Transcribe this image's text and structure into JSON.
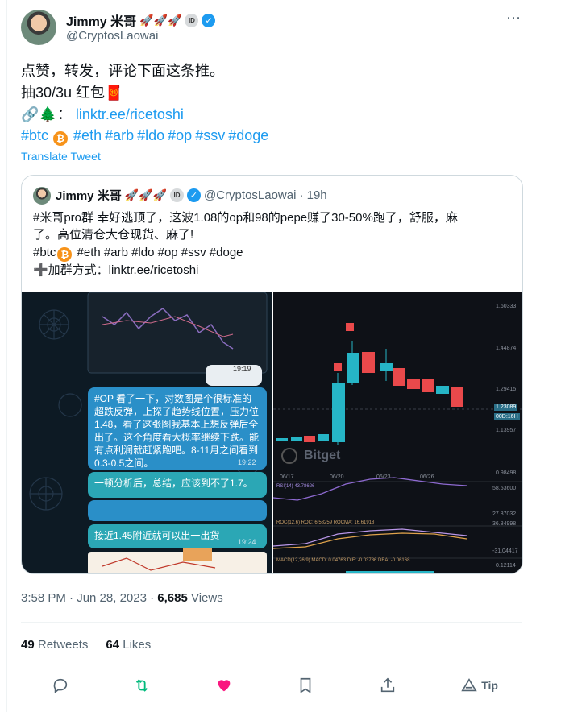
{
  "tweet": {
    "author_name": "Jimmy 米哥",
    "author_emoji": "🚀🚀🚀",
    "id_badge": "ID",
    "handle": "@CryptosLaowai",
    "more_icon": "⋯",
    "lines": [
      "点赞，转发，评论下面这条推。",
      "抽30/3u 红包🧧"
    ],
    "link_prefix": "🔗🌲：",
    "link_text": "linktr.ee/ricetoshi",
    "hashtags": [
      "#btc",
      "#eth",
      "#arb",
      "#ldo",
      "#op",
      "#ssv",
      "#doge"
    ],
    "translate_label": "Translate Tweet"
  },
  "quote": {
    "author_name": "Jimmy 米哥",
    "author_emoji": "🚀🚀🚀",
    "id_badge": "ID",
    "handle": "@CryptosLaowai",
    "time": "· 19h",
    "line1": "#米哥pro群 幸好逃顶了，这波1.08的op和98的pepe赚了30-50%跑了，舒服，麻",
    "line2": "了。高位清仓大仓现货、麻了!",
    "hashtags_pre": "#btc",
    "hashtags_post": " #eth #arb #ldo #op #ssv #doge",
    "line4": "➕加群方式：linktr.ee/ricetoshi",
    "left_image": {
      "chat1": "#OP 看了一下，对数图是个很标准的超跌反弹，上探了趋势线位置，压力位1.48，看了这张图我基本上想反弹后全出了。这个角度看大概率继续下跌。能有点利润就赶紧跑吧。8-11月之间看到0.3-0.5之间。",
      "chat1_time": "19:22",
      "chat2": "一顿分析后，总结，应该到不了1.7。",
      "chat3": "接近1.45附近就可以出一出货",
      "chat3_time": "19:24",
      "top_time": "19:19"
    },
    "right_image": {
      "price_labels": [
        "1.60333",
        "1.44874",
        "1.29415",
        "1.23089",
        "1.13957",
        "0.98498"
      ],
      "timer": "00D:16H",
      "dates": [
        "06/17",
        "06/20",
        "06/23",
        "06/26"
      ],
      "watermark": "Bitget",
      "rsi_label": "RSI(14)  43.78626",
      "rsi_levels": [
        "58.53600",
        "27.87032"
      ],
      "roc_label": "ROC(12,6)  ROC: 6.58259  ROCMA: 16.61918",
      "roc_levels": [
        "36.84998",
        "-31.04417"
      ],
      "macd_label": "MACD(12,26,9)  MACD: 0.04763  DIF: -0.03786  DEA: -0.06168",
      "macd_level": "0.12114"
    }
  },
  "meta": {
    "time": "3:58 PM · Jun 28, 2023 · ",
    "views": "6,685",
    "views_label": " Views"
  },
  "counts": {
    "retweets": "49",
    "retweets_label": " Retweets",
    "likes": "64",
    "likes_label": " Likes"
  },
  "actions": {
    "tip_label": "Tip"
  },
  "colors": {
    "accent": "#1d9bf0",
    "retweet": "#00ba7c",
    "like": "#f91880",
    "up_candle": "#26b5c6",
    "down_candle": "#e9494b"
  }
}
